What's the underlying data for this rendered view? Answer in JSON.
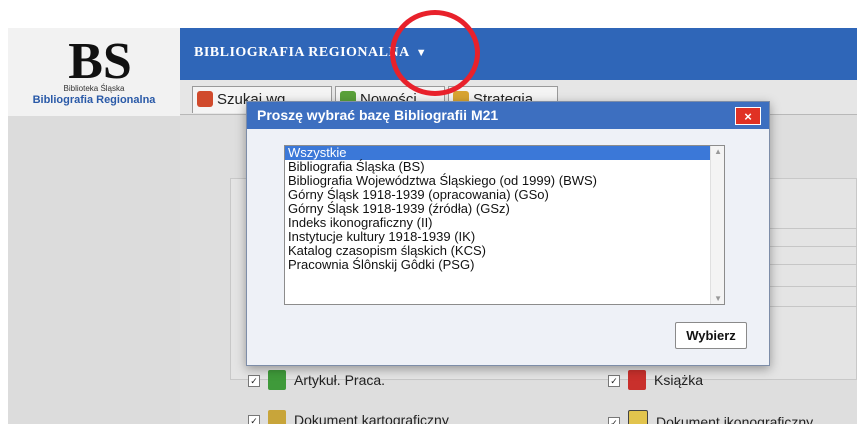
{
  "header": {
    "logo_text": "BS",
    "logo_caption_small": "Biblioteka Śląska",
    "logo_caption_big": "Bibliografia Regionalna",
    "menu_title": "BIBLIOGRAFIA REGIONALNA",
    "menu_arrow": "▼"
  },
  "tabs": [
    {
      "label": "Szukaj wg",
      "icon": "search-book-icon"
    },
    {
      "label": "Nowości",
      "icon": "new-items-icon"
    },
    {
      "label": "Strategia",
      "icon": "strategy-icon"
    }
  ],
  "dialog": {
    "title": "Proszę wybrać bazę Bibliografii M21",
    "close_label": "×",
    "options": [
      "Wszystkie",
      "Bibliografia Śląska (BS)",
      "Bibliografia Województwa Śląskiego (od 1999) (BWS)",
      "Górny Śląsk 1918-1939 (opracowania) (GSo)",
      "Górny Śląsk 1918-1939 (źródła) (GSz)",
      "Indeks ikonograficzny (II)",
      "Instytucje kultury 1918-1939 (IK)",
      "Katalog czasopism śląskich (KCS)",
      "Pracownia Ślônskij Gôdki (PSG)"
    ],
    "selected_option": "Wszystkie",
    "select_button": "Wybierz"
  },
  "filters": [
    {
      "label": "Artykuł. Praca.",
      "checked": true,
      "icon": "green-book-icon"
    },
    {
      "label": "Książka",
      "checked": true,
      "icon": "red-book-icon"
    },
    {
      "label": "Dokument kartograficzny",
      "checked": true,
      "icon": "map-icon"
    },
    {
      "label": "Dokument ikonograficzny",
      "checked": true,
      "icon": "image-icon"
    }
  ],
  "colors": {
    "topbar": "#2f66b8",
    "dialog_header": "#3d6fc0",
    "selection": "#3b78d8",
    "close": "#e03124",
    "annotation_circle": "#e8212b"
  }
}
